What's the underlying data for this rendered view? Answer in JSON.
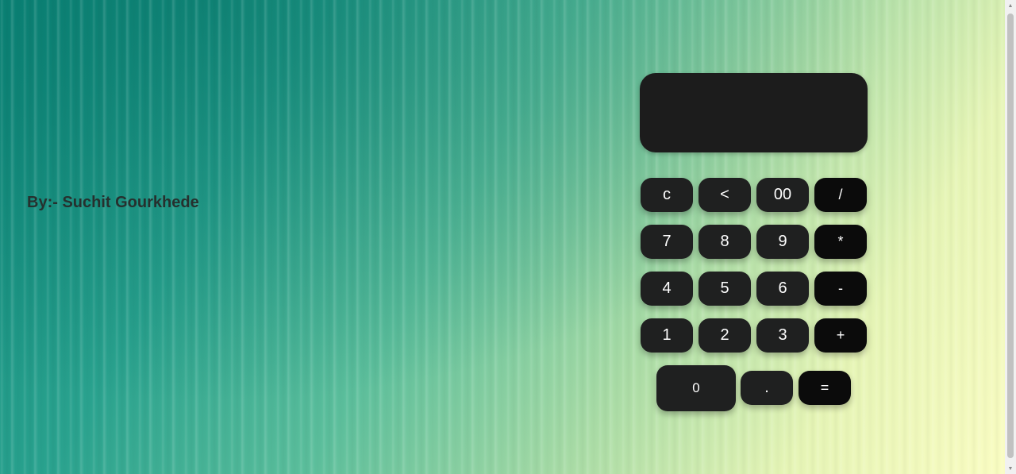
{
  "author": {
    "text": "By:- Suchit Gourkhede"
  },
  "display": {
    "value": ""
  },
  "keys": {
    "clear": "c",
    "backspace": "<",
    "double_zero": "00",
    "divide": "/",
    "seven": "7",
    "eight": "8",
    "nine": "9",
    "multiply": "*",
    "four": "4",
    "five": "5",
    "six": "6",
    "minus": "-",
    "one": "1",
    "two": "2",
    "three": "3",
    "plus": "+",
    "zero": "0",
    "dot": ".",
    "equals": "="
  },
  "colors": {
    "key_bg": "#1f2020",
    "operator_bg": "#0b0b0b",
    "display_bg": "#1c1c1c",
    "author_text": "#26302e"
  },
  "icons": {
    "scroll_up": "triangle-up-icon",
    "scroll_down": "triangle-down-icon"
  }
}
